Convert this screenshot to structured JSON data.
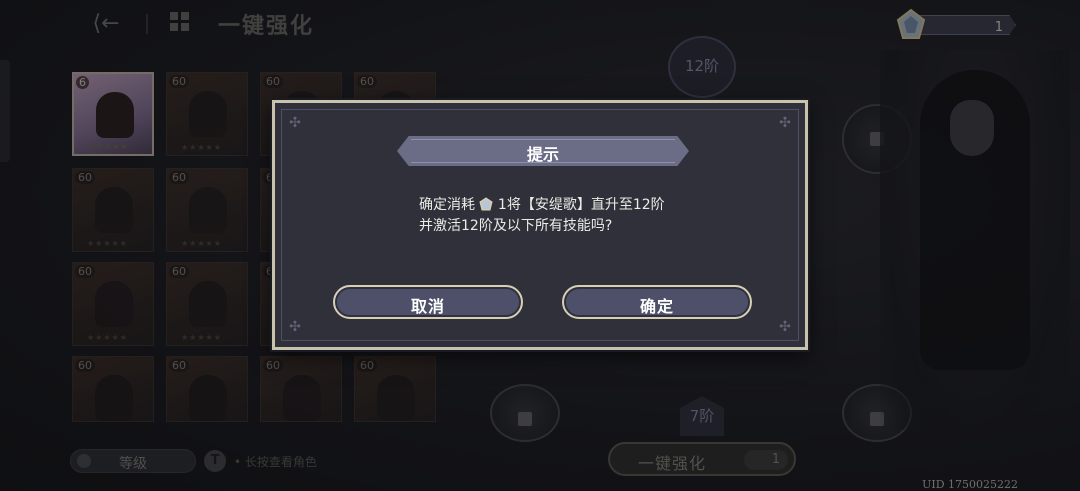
{
  "topbar": {
    "title": "一键强化"
  },
  "currency": {
    "value": "1"
  },
  "heroes": [
    {
      "level": "6",
      "active": true
    },
    {
      "level": "60"
    },
    {
      "level": "60"
    },
    {
      "level": "60"
    },
    {
      "level": "60"
    },
    {
      "level": "60"
    },
    {
      "level": "60"
    },
    {
      "level": "60"
    },
    {
      "level": "60"
    },
    {
      "level": "60"
    },
    {
      "level": "60"
    },
    {
      "level": "60"
    },
    {
      "level": "60"
    },
    {
      "level": "60"
    },
    {
      "level": "60"
    },
    {
      "level": "60"
    }
  ],
  "ranks": {
    "top": "12阶",
    "bottom": "7阶"
  },
  "bottom": {
    "sort_label": "等级",
    "hint": "• 长按查看角色",
    "oneclick_label": "一键强化",
    "oneclick_cost": "1",
    "uid": "UID 1750025222"
  },
  "dialog": {
    "title": "提示",
    "line1_prefix": "确定消耗",
    "line1_suffix": "1将【安缇歌】直升至12阶",
    "line2": "并激活12阶及以下所有技能吗?",
    "cancel_label": "取消",
    "confirm_label": "确定"
  },
  "colors": {
    "accent_gold": "#c9c2ad",
    "button_fill": "#4d5068",
    "title_bar": "#6b6d86"
  }
}
